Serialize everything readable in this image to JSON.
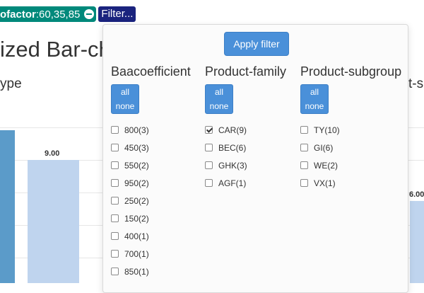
{
  "filter_pill": {
    "field": "ofactor",
    "values": ":60,35,85",
    "remove_icon": "minus-circle-icon",
    "color": "#00897b"
  },
  "filter_button": {
    "label": "Filter...",
    "color": "#1a237e"
  },
  "page": {
    "title": "ized Bar-ch",
    "subtitle_left": "ype",
    "subtitle_right": "t-su"
  },
  "chart_data": {
    "type": "bar",
    "visible_data_labels": [
      "9.00",
      "6.00"
    ],
    "values": [
      9.0,
      6.0
    ],
    "colors": {
      "dark_bar": "#5b9bc9",
      "light_bar": "#bfd4ee"
    }
  },
  "panel": {
    "apply_label": "Apply filter",
    "all_label": "all",
    "none_label": "none",
    "columns": [
      {
        "title": "Baacoefficient",
        "items": [
          {
            "label": "800(3)",
            "checked": false
          },
          {
            "label": "450(3)",
            "checked": false
          },
          {
            "label": "550(2)",
            "checked": false
          },
          {
            "label": "950(2)",
            "checked": false
          },
          {
            "label": "250(2)",
            "checked": false
          },
          {
            "label": "150(2)",
            "checked": false
          },
          {
            "label": "400(1)",
            "checked": false
          },
          {
            "label": "700(1)",
            "checked": false
          },
          {
            "label": "850(1)",
            "checked": false
          }
        ]
      },
      {
        "title": "Product-family",
        "items": [
          {
            "label": "CAR(9)",
            "checked": true
          },
          {
            "label": "BEC(6)",
            "checked": false
          },
          {
            "label": "GHK(3)",
            "checked": false
          },
          {
            "label": "AGF(1)",
            "checked": false
          }
        ]
      },
      {
        "title": "Product-subgroup",
        "items": [
          {
            "label": "TY(10)",
            "checked": false
          },
          {
            "label": "GI(6)",
            "checked": false
          },
          {
            "label": "WE(2)",
            "checked": false
          },
          {
            "label": "VX(1)",
            "checked": false
          }
        ]
      }
    ]
  }
}
